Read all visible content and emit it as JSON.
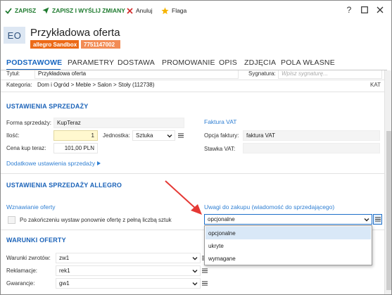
{
  "toolbar": {
    "save": "ZAPISZ",
    "save_send": "ZAPISZ I WYŚLIJ ZMIANY",
    "cancel": "Anuluj",
    "flag": "Flaga"
  },
  "window_controls": {
    "help": "?",
    "maximize": "☐",
    "close": "✕"
  },
  "header": {
    "avatar": "EO",
    "title": "Przykładowa oferta",
    "badge_env": "allegro Sandbox",
    "badge_id": "7751147002",
    "colors": {
      "badge_env": "#ec6a17",
      "badge_id": "#f28c55"
    }
  },
  "tabs": [
    "PODSTAWOWE",
    "PARAMETRY",
    "DOSTAWA",
    "PROMOWANIE",
    "OPIS",
    "ZDJĘCIA",
    "POLA WŁASNE"
  ],
  "active_tab": "PODSTAWOWE",
  "basic": {
    "title_label": "Tytuł:",
    "title_value": "Przykładowa oferta",
    "signature_label": "Sygnatura:",
    "signature_placeholder": "Wpisz sygnaturę...",
    "category_label": "Kategoria:",
    "category_value": "Dom i Ogród > Meble > Salon > Stoły (112738)",
    "category_badge": "KAT"
  },
  "sales": {
    "heading": "USTAWIENIA SPRZEDAŻY",
    "form_label": "Forma sprzedaży:",
    "form_value": "KupTeraz",
    "qty_label": "Ilość:",
    "qty_value": "1",
    "unit_label": "Jednostka:",
    "unit_value": "Sztuka",
    "price_label": "Cena kup teraz:",
    "price_value": "101,00 PLN",
    "more_link": "Dodatkowe ustawienia sprzedaży",
    "invoice_heading": "Faktura VAT",
    "invoice_option_label": "Opcja faktury:",
    "invoice_option_value": "faktura VAT",
    "vat_rate_label": "Stawka VAT:",
    "vat_rate_value": ""
  },
  "allegro": {
    "heading": "USTAWIENIA SPRZEDAŻY ALLEGRO",
    "resume_heading": "Wznawianie oferty",
    "resume_checkbox_label": "Po zakończeniu wystaw ponownie ofertę z pełną liczbą sztuk",
    "resume_checked": false,
    "notes_heading": "Uwagi do zakupu (wiadomość do sprzedającego)",
    "notes_value": "opcjonalne",
    "notes_options": [
      "opcjonalne",
      "ukryte",
      "wymagane"
    ],
    "notes_hovered": "opcjonalne"
  },
  "terms": {
    "heading": "WARUNKI OFERTY",
    "returns_label": "Warunki zwrotów:",
    "returns_value": "zw1",
    "complaints_label": "Reklamacje:",
    "complaints_value": "rek1",
    "warranty_label": "Gwarancje:",
    "warranty_value": "gw1"
  },
  "colors": {
    "accent": "#1565c0",
    "section": "#1a62b8",
    "link": "#2f7fd3",
    "save_green": "#1e7a2e",
    "annotation_arrow": "#e53935"
  }
}
